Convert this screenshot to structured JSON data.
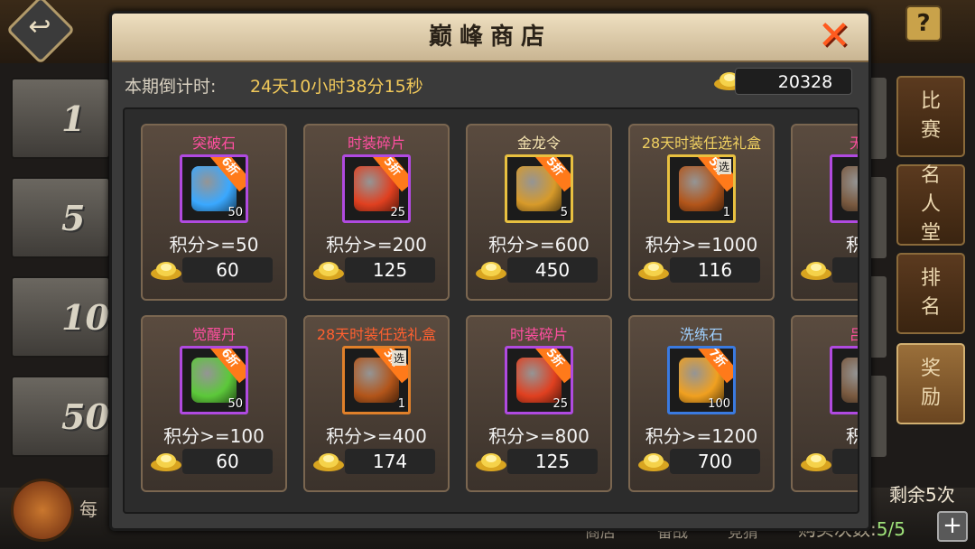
{
  "background": {
    "rows": [
      "1",
      "5",
      "10",
      "50"
    ],
    "side_tabs": [
      "比赛",
      "名人堂",
      "排名",
      "奖励"
    ],
    "daily_label": "每",
    "remaining": "剩余5次",
    "bottom_tabs": [
      "商店",
      "备战",
      "竞猜"
    ],
    "buy_count_label": "购买次数:",
    "buy_count_value": "5/5",
    "plus": "+",
    "help": "?",
    "back": "↩"
  },
  "modal": {
    "title": "巅峰商店",
    "close": "✕",
    "countdown_label": "本期倒计时:",
    "countdown_value": "24天10小时38分15秒",
    "balance": "20328"
  },
  "items": [
    {
      "name": "突破石",
      "name_color": "#ff4fa0",
      "frame": "#b04ae0",
      "art": "blue-crystal-icon",
      "art_color": "#3aa8ff",
      "qty": "50",
      "discount": "6折",
      "select": "",
      "req": "积分>=50",
      "price": "60"
    },
    {
      "name": "时装碎片",
      "name_color": "#ff4fa0",
      "frame": "#b04ae0",
      "art": "shirt-fragment-icon",
      "art_color": "#e04020",
      "qty": "25",
      "discount": "5折",
      "select": "",
      "req": "积分>=200",
      "price": "125"
    },
    {
      "name": "金龙令",
      "name_color": "#f4e3b0",
      "frame": "#e8c040",
      "art": "gold-dragon-token-icon",
      "art_color": "#d79a2a",
      "qty": "5",
      "discount": "5折",
      "select": "",
      "req": "积分>=600",
      "price": "450"
    },
    {
      "name": "28天时装任选礼盒",
      "name_color": "#f0d060",
      "frame": "#e8c040",
      "art": "gift-chest-icon",
      "art_color": "#b2551a",
      "qty": "1",
      "discount": "5折",
      "select": "选",
      "req": "积分>=1000",
      "price": "116"
    },
    {
      "name": "无双",
      "name_color": "#ff4fa0",
      "frame": "#b04ae0",
      "art": "fragment-icon",
      "art_color": "#7a5a40",
      "qty": "",
      "discount": "",
      "select": "碎",
      "req": "积分",
      "price": ""
    },
    {
      "name": "觉醒丹",
      "name_color": "#ff4fa0",
      "frame": "#b04ae0",
      "art": "green-pill-icon",
      "art_color": "#5cc83a",
      "qty": "50",
      "discount": "6折",
      "select": "",
      "req": "积分>=100",
      "price": "60"
    },
    {
      "name": "28天时装任选礼盒",
      "name_color": "#ff6030",
      "frame": "#e0802a",
      "art": "gift-chest-icon",
      "art_color": "#b2551a",
      "qty": "1",
      "discount": "3折",
      "select": "选",
      "req": "积分>=400",
      "price": "174"
    },
    {
      "name": "时装碎片",
      "name_color": "#ff4fa0",
      "frame": "#b04ae0",
      "art": "shirt-fragment-icon",
      "art_color": "#e04020",
      "qty": "25",
      "discount": "5折",
      "select": "",
      "req": "积分>=800",
      "price": "125"
    },
    {
      "name": "洗练石",
      "name_color": "#9fd0ff",
      "frame": "#3a7ae0",
      "art": "amber-stone-icon",
      "art_color": "#f0a020",
      "qty": "100",
      "discount": "7折",
      "select": "",
      "req": "积分>=1200",
      "price": "700"
    },
    {
      "name": "吕玲",
      "name_color": "#ff4fa0",
      "frame": "#b04ae0",
      "art": "fragment-icon",
      "art_color": "#7a5a40",
      "qty": "",
      "discount": "",
      "select": "碎",
      "req": "积分",
      "price": ""
    }
  ]
}
